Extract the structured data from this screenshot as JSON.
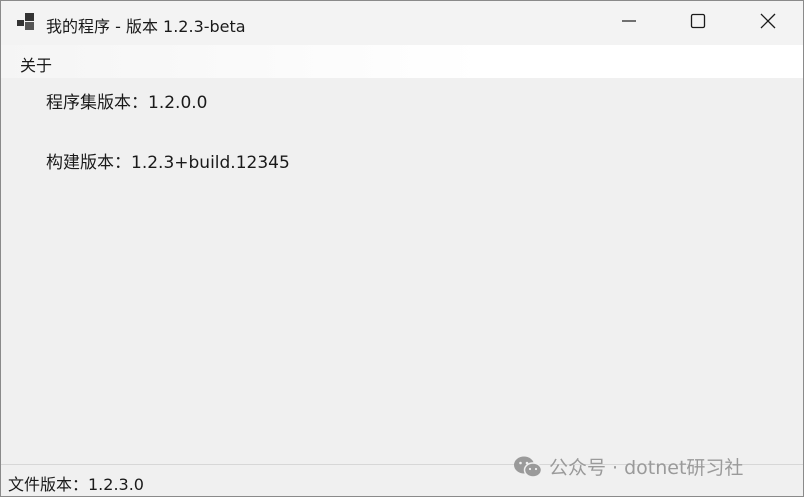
{
  "window": {
    "title": "我的程序 - 版本 1.2.3-beta",
    "icons": {
      "app": "app-window-icon",
      "minimize": "minimize-icon",
      "maximize": "maximize-icon",
      "close": "close-icon"
    }
  },
  "menu": {
    "items": [
      {
        "label": "关于"
      }
    ]
  },
  "content": {
    "assembly_version": "程序集版本：1.2.0.0",
    "build_version": "构建版本：1.2.3+build.12345"
  },
  "statusbar": {
    "file_version": "文件版本：1.2.3.0"
  },
  "watermark": {
    "text": "公众号 · dotnet研习社",
    "icon": "wechat-icon"
  },
  "colors": {
    "window_bg": "#f0f0f0",
    "titlebar_bg": "#f3f3f3",
    "text": "#1a1a1a",
    "watermark": "#9a9a9a"
  }
}
